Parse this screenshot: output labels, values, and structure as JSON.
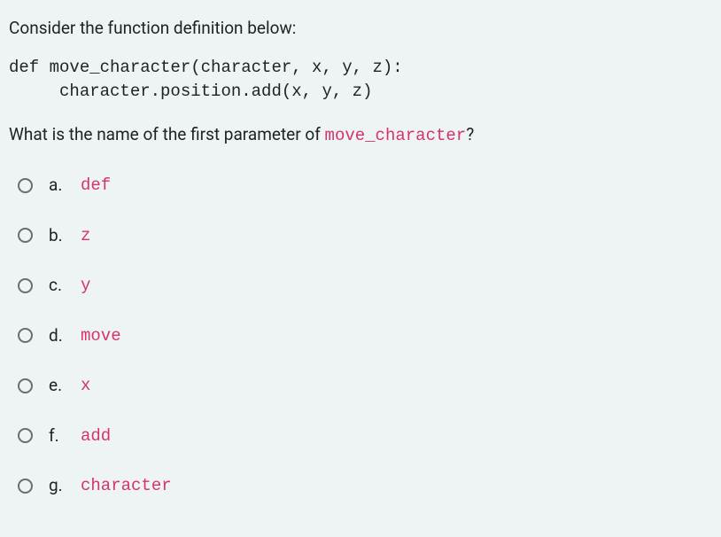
{
  "intro": "Consider the function definition below:",
  "code": "def move_character(character, x, y, z):\n     character.position.add(x, y, z)",
  "question_prefix": "What is the name of the first parameter of ",
  "question_code": "move_character",
  "question_suffix": "?",
  "options": [
    {
      "letter": "a.",
      "value": "def"
    },
    {
      "letter": "b.",
      "value": "z"
    },
    {
      "letter": "c.",
      "value": "y"
    },
    {
      "letter": "d.",
      "value": "move"
    },
    {
      "letter": "e.",
      "value": "x"
    },
    {
      "letter": "f.",
      "value": "add"
    },
    {
      "letter": "g.",
      "value": "character"
    }
  ]
}
